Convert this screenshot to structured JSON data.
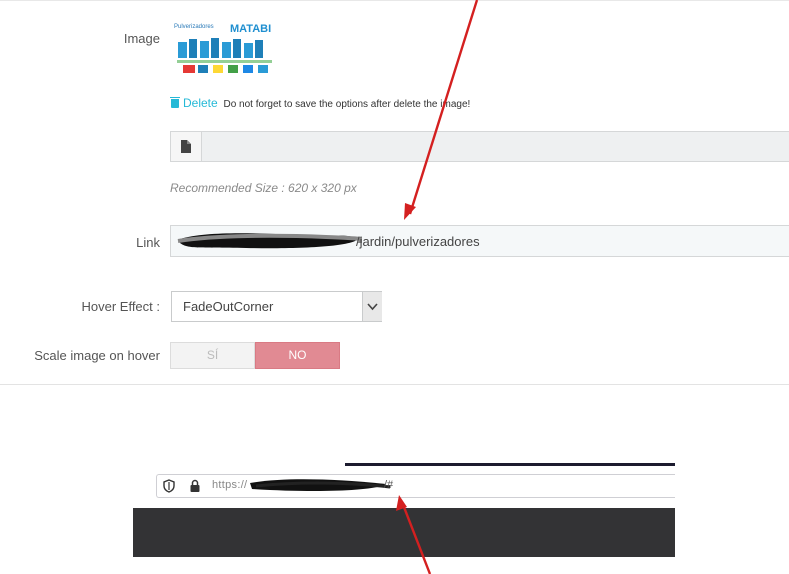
{
  "form": {
    "image_label": "Image",
    "thumbnail_brand": "MATABI",
    "thumbnail_caption": "Pulverizadores",
    "delete_label": "Delete",
    "delete_note": "Do not forget to save the options after delete the image!",
    "recommended_size": "Recommended Size : 620 x 320 px",
    "link_label": "Link",
    "link_value": "/jardin/pulverizadores",
    "hover_label": "Hover Effect :",
    "hover_value": "FadeOutCorner",
    "scale_label": "Scale image on hover",
    "toggle_yes": "SÍ",
    "toggle_no": "NO",
    "toggle_selected": "NO"
  },
  "browser": {
    "url_visible": "https://",
    "url_suffix": "/#"
  },
  "icons": {
    "delete": "trash-icon",
    "file": "file-icon",
    "dropdown": "chevron-down-icon",
    "shield": "shield-icon",
    "lock": "lock-icon"
  },
  "colors": {
    "accent": "#25b9d7",
    "toggle_no": "#e18a93",
    "arrow": "#d42020"
  }
}
